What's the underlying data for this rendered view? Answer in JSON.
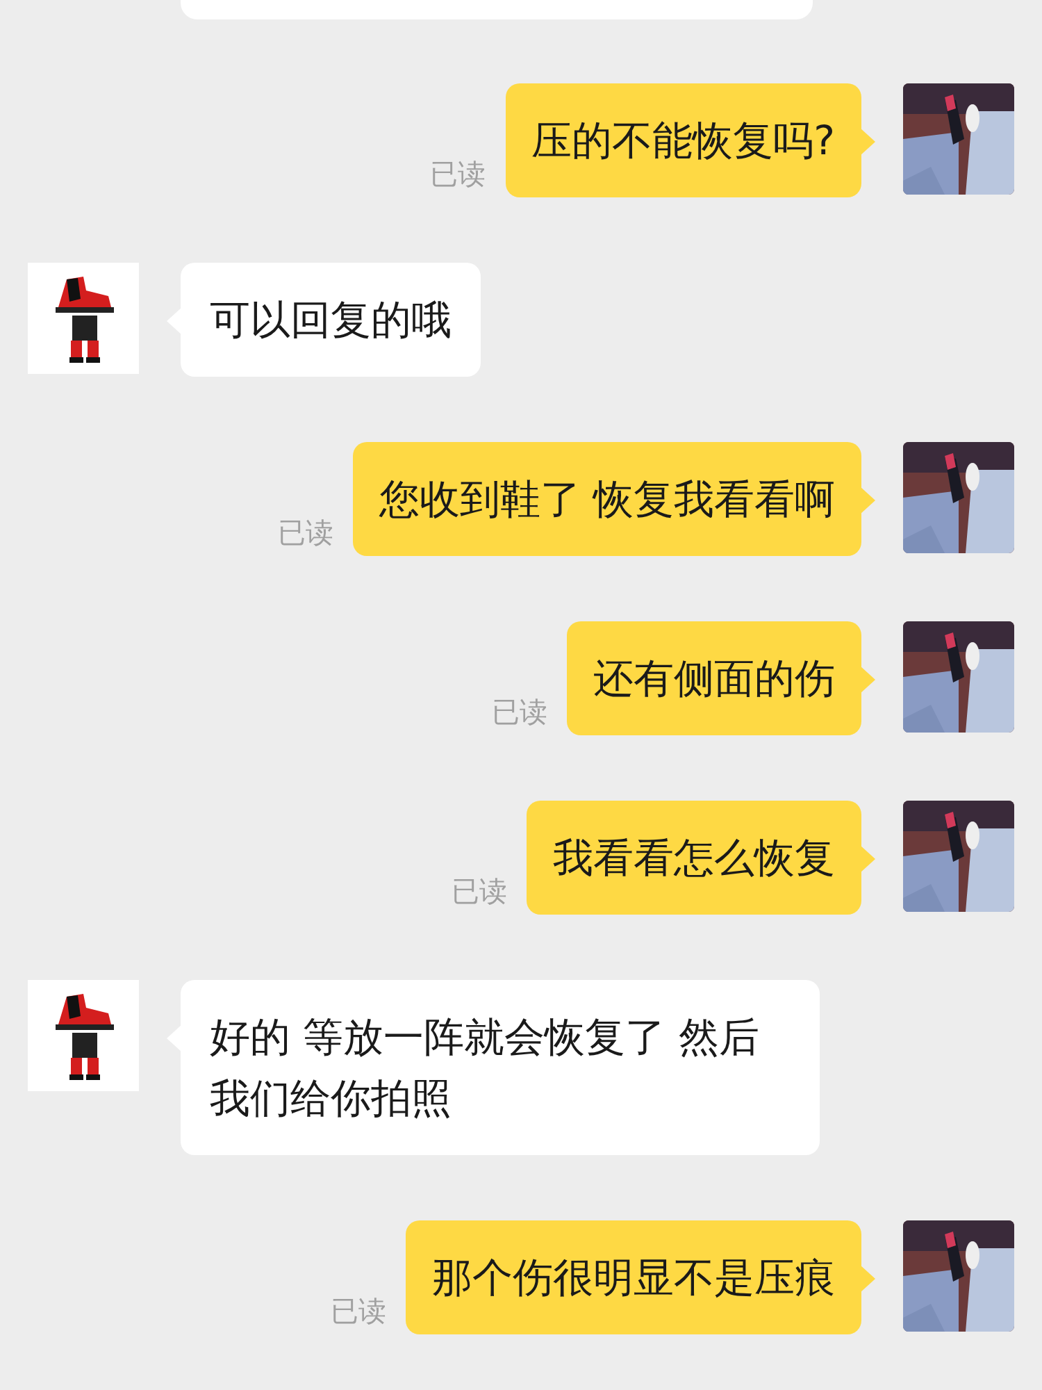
{
  "messages": [
    {
      "kind": "sent",
      "text": "压的不能恢复吗?",
      "read_label": "已读"
    },
    {
      "kind": "received",
      "text": "可以回复的哦"
    },
    {
      "kind": "sent",
      "text": "您收到鞋了 恢复我看看啊",
      "read_label": "已读"
    },
    {
      "kind": "sent",
      "text": "还有侧面的伤",
      "read_label": "已读"
    },
    {
      "kind": "sent",
      "text": "我看看怎么恢复",
      "read_label": "已读"
    },
    {
      "kind": "received",
      "text": "好的 等放一阵就会恢复了 然后我们给你拍照"
    },
    {
      "kind": "sent",
      "text": "那个伤很明显不是压痕",
      "read_label": "已读"
    }
  ]
}
